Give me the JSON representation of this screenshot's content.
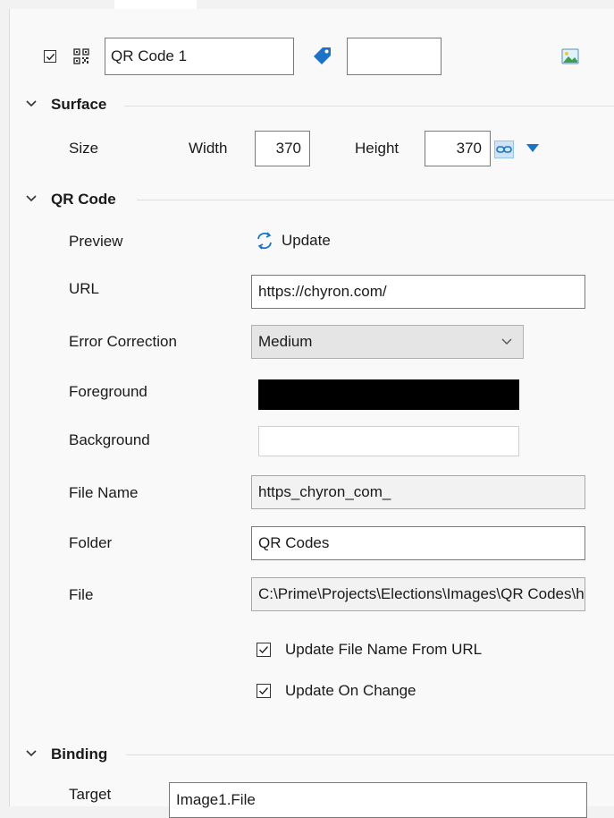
{
  "header": {
    "enabled": true,
    "name_value": "QR Code 1",
    "tag_value": "",
    "qr_icon": "qr-code-icon",
    "tag_icon": "tag-icon",
    "image_icon": "image-icon"
  },
  "surface": {
    "title": "Surface",
    "size_label": "Size",
    "width_label": "Width",
    "width_value": "370",
    "height_label": "Height",
    "height_value": "370",
    "link_icon": "link-icon",
    "dropdown_icon": "triangle-down-icon"
  },
  "qr": {
    "title": "QR Code",
    "preview_label": "Preview",
    "update_label": "Update",
    "refresh_icon": "refresh-icon",
    "url_label": "URL",
    "url_value": "https://chyron.com/",
    "error_label": "Error Correction",
    "error_value": "Medium",
    "fg_label": "Foreground",
    "fg_color": "#000000",
    "bg_label": "Background",
    "bg_color": "#ffffff",
    "filename_label": "File Name",
    "filename_value": "https_chyron_com_",
    "folder_label": "Folder",
    "folder_value": "QR Codes",
    "file_label": "File",
    "file_value": "C:\\Prime\\Projects\\Elections\\Images\\QR Codes\\https_chyron_com_.png",
    "opt_update_filename": {
      "label": "Update File Name From URL",
      "checked": true
    },
    "opt_update_change": {
      "label": "Update On Change",
      "checked": true
    }
  },
  "binding": {
    "title": "Binding",
    "target_label": "Target",
    "target_value": "Image1.File"
  },
  "colors": {
    "accent": "#1a73c9",
    "section_rule": "#dedede"
  }
}
